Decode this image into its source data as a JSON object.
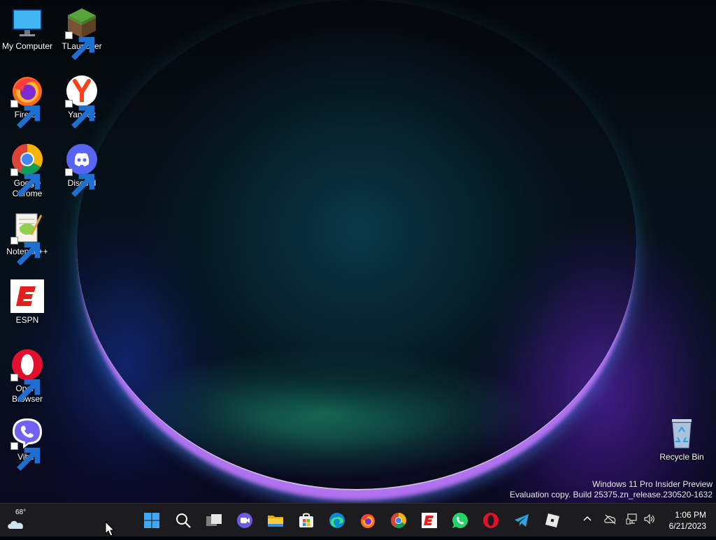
{
  "desktop": {
    "icons": [
      {
        "id": "my-computer",
        "label": "My Computer"
      },
      {
        "id": "tlauncher",
        "label": "TLauncher"
      },
      {
        "id": "firefox",
        "label": "Firefox"
      },
      {
        "id": "yandex",
        "label": "Yandex"
      },
      {
        "id": "chrome",
        "label": "Google Chrome"
      },
      {
        "id": "discord",
        "label": "Discord"
      },
      {
        "id": "notepadpp",
        "label": "Notepad++"
      },
      {
        "id": "espn",
        "label": "ESPN"
      },
      {
        "id": "opera",
        "label": "Opera Browser"
      },
      {
        "id": "viber",
        "label": "Viber"
      },
      {
        "id": "recycle-bin",
        "label": "Recycle Bin"
      }
    ]
  },
  "watermark": {
    "line1": "Windows 11 Pro Insider Preview",
    "line2": "Evaluation copy. Build 25375.zn_release.230520-1632"
  },
  "taskbar": {
    "weather": {
      "temp": "68°"
    },
    "pinned": [
      "start-icon",
      "search-icon",
      "task-view-icon",
      "teams-chat-icon",
      "file-explorer-icon",
      "microsoft-store-icon",
      "edge-icon",
      "firefox-icon",
      "chrome-icon",
      "espn-icon",
      "whatsapp-icon",
      "opera-icon",
      "telegram-icon",
      "roblox-icon"
    ],
    "tray": [
      "chevron-up-icon",
      "onedrive-offline-icon",
      "network-icon",
      "volume-icon"
    ],
    "clock": {
      "time": "1:06 PM",
      "date": "6/21/2023"
    }
  },
  "colors": {
    "taskbar_bg": "#1c1c1e",
    "accent": "#0078d4"
  }
}
